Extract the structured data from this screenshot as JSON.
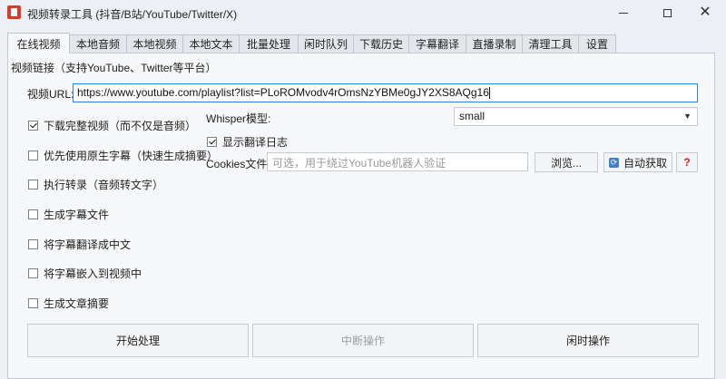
{
  "window": {
    "title": "视频转录工具 (抖音/B站/YouTube/Twitter/X)",
    "min_label": "—",
    "close_label": "✕"
  },
  "tabs": [
    {
      "label": "在线视频",
      "active": true
    },
    {
      "label": "本地音频"
    },
    {
      "label": "本地视频"
    },
    {
      "label": "本地文本"
    },
    {
      "label": "批量处理"
    },
    {
      "label": "闲时队列"
    },
    {
      "label": "下载历史"
    },
    {
      "label": "字幕翻译"
    },
    {
      "label": "直播录制"
    },
    {
      "label": "清理工具"
    },
    {
      "label": "设置"
    }
  ],
  "group_title": "视频链接（支持YouTube、Twitter等平台）",
  "url": {
    "label": "视频URL:",
    "value": "https://www.youtube.com/playlist?list=PLoROMvodv4rOmsNzYBMe0gJY2XS8AQg16"
  },
  "checkboxes": [
    {
      "label": "下载完整视频（而不仅是音频）",
      "checked": true
    },
    {
      "label": "优先使用原生字幕（快速生成摘要）",
      "checked": false
    },
    {
      "label": "执行转录（音频转文字）",
      "checked": false
    },
    {
      "label": "生成字幕文件",
      "checked": false
    },
    {
      "label": "将字幕翻译成中文",
      "checked": false
    },
    {
      "label": "将字幕嵌入到视频中",
      "checked": false
    },
    {
      "label": "生成文章摘要",
      "checked": false
    }
  ],
  "whisper": {
    "label": "Whisper模型:",
    "selected": "small"
  },
  "show_log": {
    "label": "显示翻译日志",
    "checked": true
  },
  "cookies": {
    "label": "Cookies文件:",
    "placeholder": "可选，用于绕过YouTube机器人验证",
    "browse_label": "浏览...",
    "auto_label": "自动获取",
    "help_label": "?"
  },
  "actions": {
    "start_label": "开始处理",
    "stop_label": "中断操作",
    "idle_label": "闲时操作"
  },
  "colors": {
    "accent": "#2f7fd4",
    "help": "#d32020",
    "app_icon": "#d93a2b"
  }
}
